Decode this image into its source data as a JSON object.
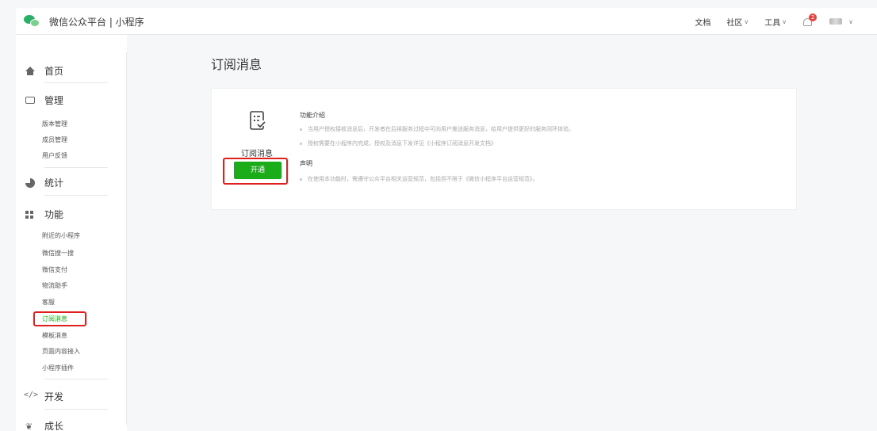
{
  "header": {
    "title": "微信公众平台 | 小程序",
    "nav": {
      "docs": "文档",
      "community": "社区",
      "tools": "工具",
      "notification_count": "2"
    }
  },
  "sidebar": {
    "sections": {
      "home": "首页",
      "manage": "管理",
      "stats": "统计",
      "features": "功能",
      "dev": "开发",
      "growth": "成长"
    },
    "manage_items": [
      "版本管理",
      "成员管理",
      "用户反馈"
    ],
    "feature_items": [
      "附近的小程序",
      "微信搜一搜",
      "微信支付",
      "物流助手",
      "客服",
      "订阅消息",
      "模板消息",
      "页面内容接入",
      "小程序插件"
    ],
    "active_item": "订阅消息"
  },
  "main": {
    "title": "订阅消息",
    "feature_name": "订阅消息",
    "open_button": "开通",
    "intro_title": "功能介绍",
    "intro_items": [
      "当用户授权接收消息后，开发者在后续服务过程中可向用户推送服务消息，给用户提供更好的服务闭环体验。",
      "授权需要在小程序内完成，授权及消息下发详见《小程序订阅消息开发文档》"
    ],
    "statement_title": "声明",
    "statement_items": [
      "在使用本功能时，需遵守公众平台相关运营规范，包括但不限于《微信小程序平台运营规范》。"
    ]
  },
  "colors": {
    "accent": "#1aad19",
    "highlight": "#e02020",
    "badge": "#e64340"
  }
}
